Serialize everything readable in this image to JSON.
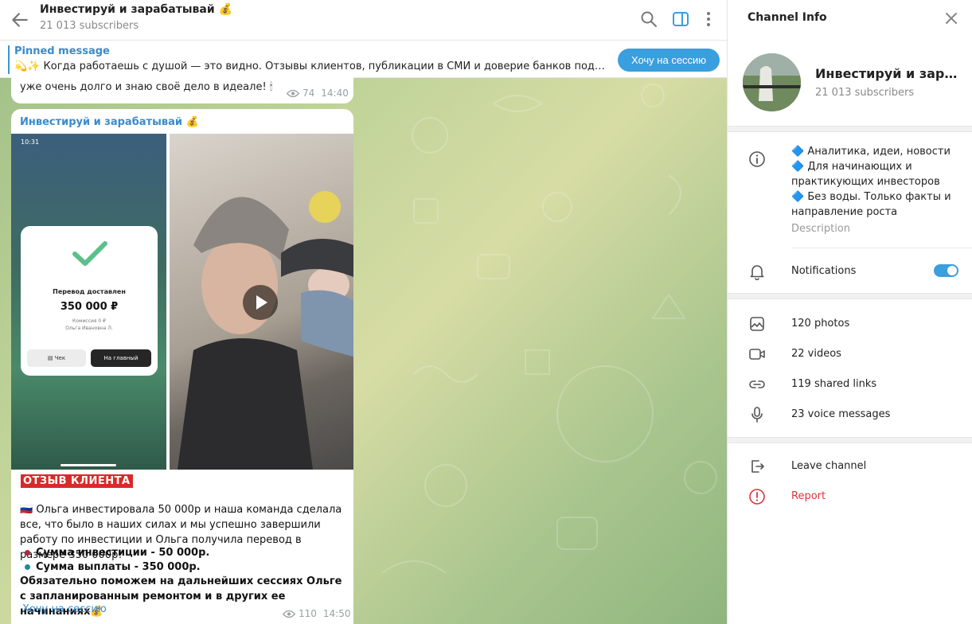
{
  "header": {
    "title": "Инвестируй и зарабатывай 💰",
    "subscribers": "21 013 subscribers"
  },
  "pinned": {
    "title": "Pinned message",
    "text": "💫✨ Когда работаешь с душой — это видно. Отзывы клиентов, публикации в СМИ и доверие банков подтверждают: м...",
    "button": "Хочу на сессию"
  },
  "prev_message": {
    "text": "уже очень долго и знаю своё дело в идеале! 🕯",
    "views": "74",
    "time": "14:40"
  },
  "message": {
    "author": "Инвестируй и зарабатывай 💰",
    "receipt": {
      "status_time": "10:31",
      "title": "Перевод доставлен",
      "amount": "350 000 ₽",
      "commission": "Комиссия 0 ₽",
      "recipient": "Ольга Ивановна Л.",
      "btn_receipt": "Чек",
      "btn_home": "На главный"
    },
    "tag": "ОТЗЫВ КЛИЕНТА",
    "body": "🇷🇺 Ольга инвестировала 50 000р и наша команда сделала все, что было в наших силах и мы успешно завершили работу по инвестиции и Ольга получила перевод в размере 350 000р!",
    "bullet1": "Сумма инвестиции - 50 000р.",
    "bullet2": "Сумма выплаты - 350 000р.",
    "closing": "Обязательно поможем на дальнейших сессиях Ольге с запланированным ремонтом и в других ее начинаниях💰",
    "link": "Хочу на сессию",
    "views": "110",
    "time": "14:50"
  },
  "info": {
    "header": "Channel Info",
    "name": "Инвестируй и зарабатывай 💰",
    "subscribers": "21 013 subscribers",
    "desc1": "🔷 Аналитика, идеи, новости",
    "desc2": "🔷 Для начинающих и практикующих инвесторов",
    "desc3": "🔷 Без воды. Только факты и направление роста",
    "desc_label": "Description",
    "notifications": "Notifications",
    "notifications_on": true,
    "photos": "120 photos",
    "videos": "22 videos",
    "links": "119 shared links",
    "voice": "23 voice messages",
    "leave": "Leave channel",
    "report": "Report"
  },
  "colors": {
    "accent": "#3a9fdf",
    "link": "#3a8bc9",
    "danger": "#e2343c",
    "tag_bg": "#d82a2a"
  }
}
